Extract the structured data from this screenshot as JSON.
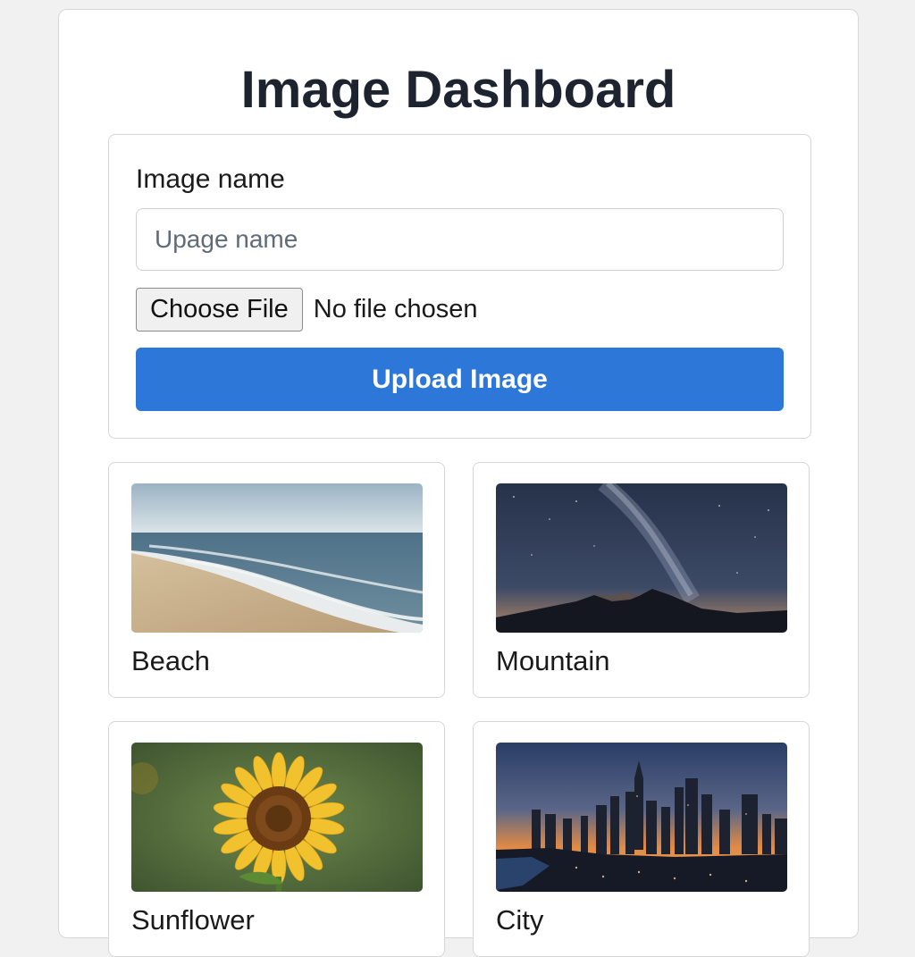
{
  "page": {
    "title": "Image Dashboard"
  },
  "upload_form": {
    "name_label": "Image name",
    "name_placeholder": "Upage name",
    "name_value": "",
    "choose_file_label": "Choose File",
    "file_status": "No file chosen",
    "upload_button_label": "Upload Image"
  },
  "gallery": {
    "items": [
      {
        "caption": "Beach",
        "image": "beach-photo"
      },
      {
        "caption": "Mountain",
        "image": "night-mountain-photo"
      },
      {
        "caption": "Sunflower",
        "image": "sunflower-photo"
      },
      {
        "caption": "City",
        "image": "city-skyline-photo"
      }
    ]
  },
  "colors": {
    "accent": "#2d77d8",
    "page_background": "#f1f1f1",
    "card_border": "#d6d6d6",
    "title_text": "#1d2430"
  }
}
